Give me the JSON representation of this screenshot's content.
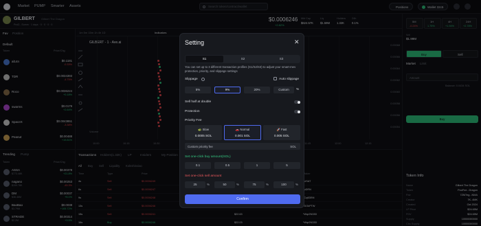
{
  "topbar": {
    "nav": [
      "Market",
      "PUMP",
      "Smarter",
      "Assets"
    ],
    "search_placeholder": "Search token/contract/wallet",
    "positions_label": "Positions",
    "wallet_label": "Wallet 32c5"
  },
  "token": {
    "name": "GILBERT",
    "fullname": "Gilbert The Dragon",
    "price": "$0.0006246",
    "change": "+2.82%",
    "stats": [
      {
        "label": "Mkt Cap",
        "value": "$624.57K"
      },
      {
        "label": "Liq",
        "value": "$1.59M"
      },
      {
        "label": "Holders",
        "value": "1.32K"
      },
      {
        "label": "24h",
        "value": "0.1%"
      }
    ],
    "meta": "Pnd2...Summ  ·  1 days  ·  0  ·  0  ·  0  ·  0"
  },
  "watchlist": {
    "tabs": [
      "Fav",
      "Position"
    ],
    "header_token": "Token",
    "header_price": "Price/Chg",
    "filter": "Default",
    "items": [
      {
        "name": "al14n",
        "price": "$0.1181",
        "change": "-0.33%",
        "color": "#4b7bd6",
        "dir": "down"
      },
      {
        "name": "TDR",
        "price": "$0.0034393",
        "change": "-4.75%",
        "color": "#c9c9c9",
        "dir": "down"
      },
      {
        "name": "Roco",
        "price": "$0.0036224",
        "change": "+0.18%",
        "color": "#8a6f4c",
        "dir": "up"
      },
      {
        "name": "swarms",
        "price": "$0.0179",
        "change": "+2.64%",
        "color": "#b34ad6",
        "dir": "up"
      },
      {
        "name": "SpaceX",
        "price": "$0.0043851",
        "change": "-3.38%",
        "color": "#d6d6d6",
        "dir": "down"
      },
      {
        "name": "Peanut",
        "price": "$0.00488",
        "change": "+19.81%",
        "color": "#d0a556",
        "dir": "up"
      }
    ]
  },
  "chart": {
    "toolbar_label": "GILBERT - 1 - Ave.ai",
    "indicators_label": "Indicators",
    "volume_label": "Volume",
    "xticks": [
      "10:00",
      "10:15",
      "10:30",
      "10:45",
      "11:00",
      "11:15",
      "11:30",
      "11:45",
      "12:00",
      "12:15"
    ],
    "yticks": [
      "0.00068",
      "0.00066",
      "0.00064",
      "0.00062",
      "0.00060",
      "0.00058",
      "0.00056",
      "0.00054"
    ]
  },
  "trending": {
    "tabs": [
      "Trending",
      "Pump"
    ],
    "header_token": "Token",
    "header_price": "Price/Chg",
    "items": [
      {
        "name": "ASSA",
        "price": "$0.00378",
        "change": "+21.8%",
        "cap": "$773.48K",
        "dir": "up"
      },
      {
        "name": "nagano",
        "price": "$0.00253",
        "change": "-45.3%",
        "cap": "$159.78K",
        "dir": "down"
      },
      {
        "name": "DM",
        "price": "$0.00037",
        "change": "+5.1%",
        "cap": "$36.46M",
        "dir": "up"
      },
      {
        "name": "BaoBao",
        "price": "$0.0038",
        "change": "+105.72%",
        "cap": "$3.79M",
        "dir": "up"
      },
      {
        "name": "STRADE",
        "price": "$0.00314",
        "change": "+3.5%",
        "cap": "$2.2M",
        "dir": "up"
      }
    ]
  },
  "transactions": {
    "tabs": [
      "Transactions",
      "Holders(1.32K)",
      "LP",
      "Insiders",
      "My Position"
    ],
    "filters": [
      "All",
      "Buy",
      "Sell",
      "Liquidity",
      "Kolnshinxiao"
    ],
    "columns": [
      "Time",
      "Type",
      "Price",
      "Amount",
      "Total",
      "Maker"
    ],
    "rows": [
      {
        "time": "4s",
        "type": "Sell",
        "price": "$0.0006249",
        "amount": "",
        "total": "",
        "maker": "*USAT"
      },
      {
        "time": "6s",
        "type": "Sell",
        "price": "$0.0006247",
        "amount": "",
        "total": "",
        "maker": "*pDRN"
      },
      {
        "time": "9s",
        "type": "Sell",
        "price": "$0.0006248",
        "amount": "",
        "total": "",
        "maker": "*Cq6DBN"
      },
      {
        "time": "13s",
        "type": "Sell",
        "price": "$0.0006246",
        "amount": "",
        "total": "",
        "maker": "*DOkPTW"
      },
      {
        "time": "15s",
        "type": "Sell",
        "price": "$0.0006241",
        "amount": "",
        "total": "$22.63",
        "maker": "*Wqr2N33D"
      },
      {
        "time": "16s",
        "type": "Buy",
        "price": "$0.0006246",
        "amount": "",
        "total": "$22.03",
        "maker": "*Wqr2N33D"
      }
    ]
  },
  "right_panel": {
    "timeframes": [
      {
        "label": "5M",
        "value": "-0.24%"
      },
      {
        "label": "1H",
        "value": "1.75%"
      },
      {
        "label": "4H",
        "value": "+1.94%"
      },
      {
        "label": "24H",
        "value": "+2.78%"
      }
    ],
    "vol_label": "Vol",
    "vol_value": "$1.99M",
    "buy_label": "Buy",
    "sell_label": "Sell",
    "market_label": "Market",
    "limit_label": "Limit",
    "amount_label": "Amount",
    "balance": "Balance: 0.0434 SOL",
    "buy_btn": "Buy",
    "token_info_title": "Token Info",
    "info_rows": [
      {
        "k": "Name",
        "v": "Gilbert The Dragon"
      },
      {
        "k": "Token",
        "v": "PooFne...Dragon"
      },
      {
        "k": "Pair",
        "v": "7ZM7eg...NMA"
      },
      {
        "k": "Creator",
        "v": "7K..4MK"
      },
      {
        "k": "Created",
        "v": "Oct 2024"
      },
      {
        "k": "LP Price",
        "v": "$24.65M"
      },
      {
        "k": "FDV",
        "v": "$24.65M"
      },
      {
        "k": "Supply",
        "v": "10000000000"
      },
      {
        "k": "Circ Supply",
        "v": "10000000000"
      }
    ]
  },
  "modal": {
    "title": "Setting",
    "close_glyph": "✕",
    "profile_tabs": [
      "S1",
      "S2",
      "S3"
    ],
    "active_profile": "S1",
    "description": "You can set up to 3 different transaction profiles (S1/S2/S3) to adjust your smart-mev protection, priority, and slippage settings",
    "slippage_label": "Slippage",
    "auto_slippage_label": "Auto slippage",
    "slippage_options": [
      "5%",
      "9%",
      "20%"
    ],
    "slippage_selected": "9%",
    "custom_label": "Custom",
    "custom_unit": "%",
    "sell_half_label": "Sell half at double",
    "protection_label": "Protection",
    "priority_label": "Priority Fee",
    "fees": [
      {
        "name": "Slow",
        "value": "0.0005 SOL",
        "icon": "turtle-icon"
      },
      {
        "name": "Normal",
        "value": "0.001 SOL",
        "icon": "car-icon"
      },
      {
        "name": "Fast",
        "value": "0.005 SOL",
        "icon": "rocket-icon"
      }
    ],
    "fee_selected": "Normal",
    "custom_fee_label": "Custom priority fee",
    "custom_fee_unit": "SOL",
    "buy_amount_label": "Set one-click buy amount(SOL)",
    "buy_amounts": [
      "0.1",
      "0.5",
      "1",
      "5"
    ],
    "sell_amount_label": "Set one-click sell amount",
    "sell_amounts": [
      "25",
      "50",
      "75",
      "100"
    ],
    "sell_unit": "%",
    "confirm_label": "Confirm"
  }
}
